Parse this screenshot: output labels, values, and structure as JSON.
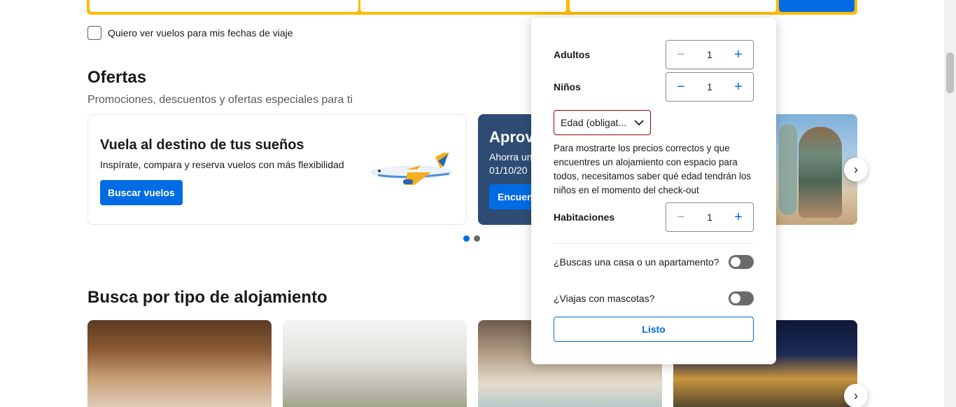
{
  "flights_checkbox": {
    "label": "Quiero ver vuelos para mis fechas de viaje",
    "checked": false
  },
  "offers": {
    "title": "Ofertas",
    "subtitle": "Promociones, descuentos y ofertas especiales para ti",
    "card": {
      "title": "Vuela al destino de tus sueños",
      "text": "Inspírate, compara y reserva vuelos con más flexibilidad",
      "button": "Buscar vuelos"
    },
    "promo": {
      "title": "Aprov",
      "text_line1": "Ahorra un",
      "text_line2": "01/10/20",
      "button": "Encuent"
    },
    "next_icon": "›",
    "pagination": {
      "total": 2,
      "active": 1
    }
  },
  "property_types": {
    "title": "Busca por tipo de alojamiento",
    "next_icon": "›"
  },
  "occupancy": {
    "adults": {
      "label": "Adultos",
      "value": "1"
    },
    "children": {
      "label": "Niños",
      "value": "1"
    },
    "age_select": {
      "placeholder": "Edad (obligat..."
    },
    "age_note": "Para mostrarte los precios correctos y que encuentres un alojamiento con espacio para todos, necesitamos saber qué edad tendrán los niños en el momento del check-out",
    "rooms": {
      "label": "Habitaciones",
      "value": "1"
    },
    "house_toggle": {
      "label": "¿Buscas una casa o un apartamento?",
      "on": false
    },
    "pets_toggle": {
      "label": "¿Viajas con mascotas?",
      "on": false
    },
    "done": "Listo",
    "minus_icon": "−",
    "plus_icon": "+"
  },
  "colors": {
    "accent": "#006ce4",
    "brand_yellow": "#febb02",
    "error": "#a30000"
  }
}
